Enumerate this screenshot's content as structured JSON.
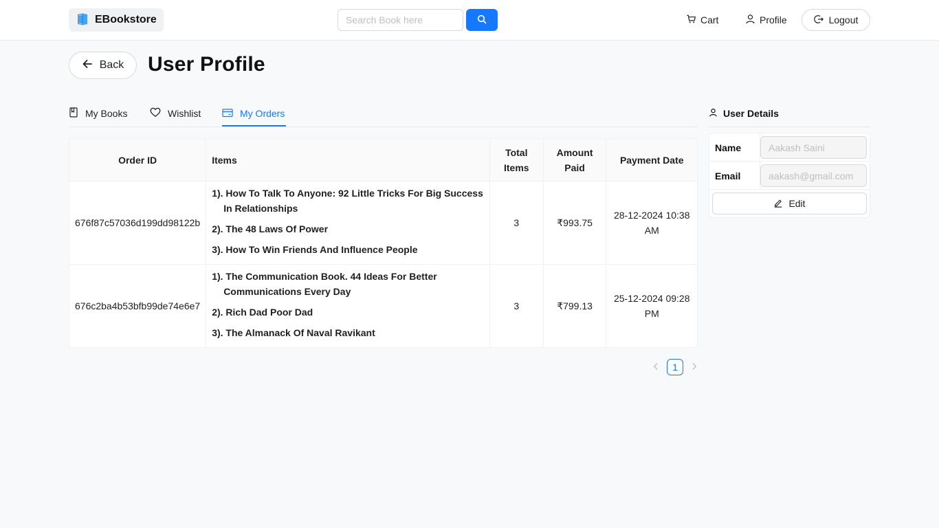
{
  "header": {
    "brand": "EBookstore",
    "search_placeholder": "Search Book here",
    "cart_label": "Cart",
    "profile_label": "Profile",
    "logout_label": "Logout"
  },
  "page": {
    "back_label": "Back",
    "title": "User Profile"
  },
  "tabs": [
    {
      "label": "My Books",
      "icon": "book-icon",
      "active": false
    },
    {
      "label": "Wishlist",
      "icon": "heart-icon",
      "active": false
    },
    {
      "label": "My Orders",
      "icon": "credit-card-icon",
      "active": true
    }
  ],
  "orders_table": {
    "columns": [
      "Order ID",
      "Items",
      "Total Items",
      "Amount Paid",
      "Payment Date"
    ],
    "rows": [
      {
        "order_id": "676f87c57036d199dd98122b",
        "items": [
          "1). How To Talk To Anyone: 92 Little Tricks For Big Success In Relationships",
          "2). The 48 Laws Of Power",
          "3). How To Win Friends And Influence People"
        ],
        "total_items": "3",
        "amount_paid": "₹993.75",
        "payment_date": "28-12-2024 10:38 AM"
      },
      {
        "order_id": "676c2ba4b53bfb99de74e6e7",
        "items": [
          "1). The Communication Book. 44 Ideas For Better Communications Every Day",
          "2). Rich Dad Poor Dad",
          "3). The Almanack Of Naval Ravikant"
        ],
        "total_items": "3",
        "amount_paid": "₹799.13",
        "payment_date": "25-12-2024 09:28 PM"
      }
    ]
  },
  "pagination": {
    "current_page": "1"
  },
  "user_details": {
    "title": "User Details",
    "name_label": "Name",
    "name_value": "Aakash Saini",
    "email_label": "Email",
    "email_value": "aakash@gmail.com",
    "edit_label": "Edit"
  },
  "colors": {
    "accent": "#1677ff",
    "amount": "#e53935"
  }
}
